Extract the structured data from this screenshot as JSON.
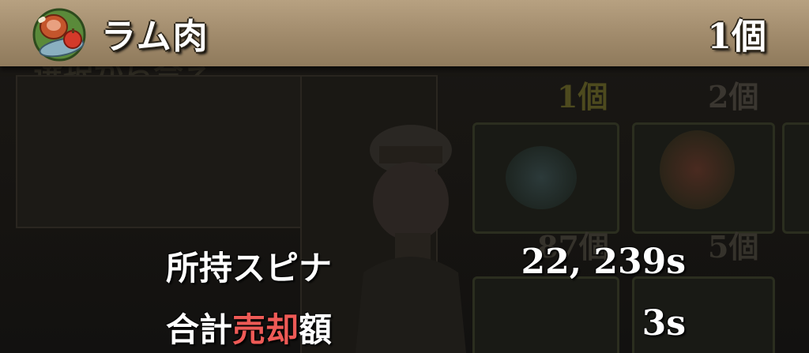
{
  "header": {
    "item_icon": "meat-fish-apple-icon",
    "item_name": "ラム肉",
    "item_count": "1個"
  },
  "background": {
    "heading_partial": "選択から合え",
    "count_top_1": "1個",
    "count_top_2": "2個",
    "count_mid_1": "87個",
    "count_mid_2": "5個"
  },
  "summary": {
    "owned_label": "所持スピナ",
    "owned_value": "22, 239s",
    "total_label_prefix": "合計",
    "total_label_accent": "売却",
    "total_label_suffix": "額",
    "total_value": "3s"
  },
  "colors": {
    "header_bar": "#a8926f",
    "accent_red": "#ee5a56",
    "count_yellow": "#6b6a2a",
    "text_white": "#ffffff"
  }
}
